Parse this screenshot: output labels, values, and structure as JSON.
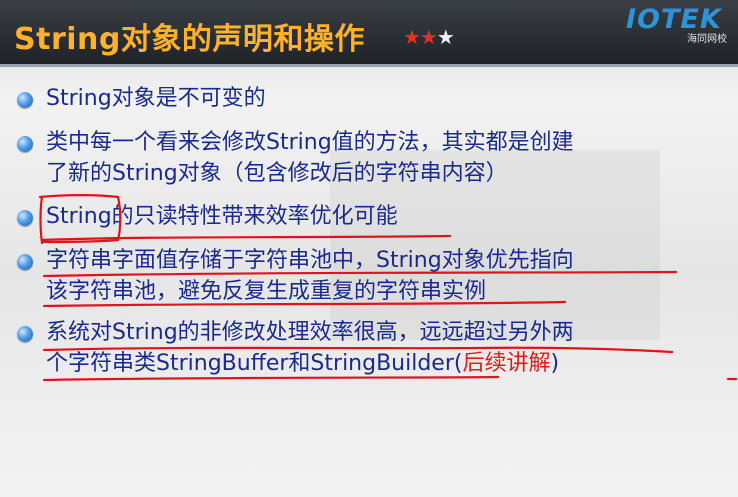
{
  "slide": {
    "title": "String对象的声明和操作",
    "rating": {
      "filled": "★★",
      "empty": "★",
      "filled_count": 2,
      "total": 3
    },
    "logo": {
      "text": "IOTEK",
      "subtitle": "海同网校"
    }
  },
  "bullets": [
    {
      "lines": [
        "String对象是不可变的"
      ]
    },
    {
      "lines": [
        "类中每一个看来会修改String值的方法，其实都是创建",
        "了新的String对象（包含修改后的字符串内容）"
      ]
    },
    {
      "lines": [
        "String的只读特性带来效率优化可能"
      ]
    },
    {
      "lines": [
        "字符串字面值存储于字符串池中，String对象优先指向",
        "该字符串池，避免反复生成重复的字符串实例"
      ]
    },
    {
      "lines": [
        "系统对String的非修改处理效率很高，远远超过另外两",
        "个字符串类StringBuffer和StringBuilder("
      ],
      "red_note": "后续讲解",
      "closing": ")"
    }
  ],
  "colors": {
    "title": "#ffb12a",
    "text": "#1a2a8c",
    "annotation": "#e0141b",
    "bullet": "#4d9be8"
  }
}
